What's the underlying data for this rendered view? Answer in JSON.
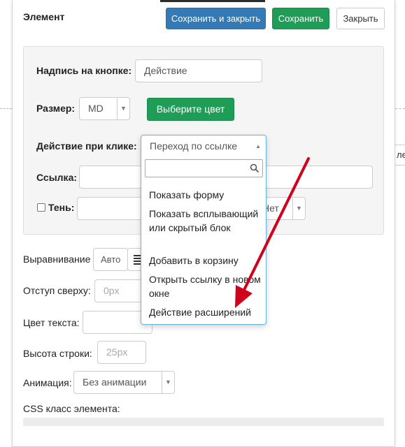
{
  "dialog": {
    "title": "Элемент",
    "buttons": {
      "save_close": "Сохранить и закрыть",
      "save": "Сохранить",
      "close": "Закрыть"
    }
  },
  "form": {
    "button_label": {
      "label": "Надпись на кнопке:",
      "value": "Действие"
    },
    "size": {
      "label": "Размер:",
      "value": "MD",
      "color_button": "Выберите цвет"
    },
    "click_action": {
      "label": "Действие при клике:",
      "selected": "Переход по ссылке",
      "search_value": "",
      "options": [
        "Показать форму",
        "Показать всплывающий или скрытый блок",
        "Добавить в корзину",
        "Открыть ссылку в новом окне",
        "Действие расширений"
      ]
    },
    "link": {
      "label": "Ссылка:",
      "value": ""
    },
    "shadow": {
      "label": "Тень:",
      "checked": false,
      "select_value": "Нет"
    },
    "alignment": {
      "label": "Выравнивание",
      "value": "Авто"
    },
    "margin_top": {
      "label": "Отступ сверху:",
      "placeholder": "0px"
    },
    "text_color": {
      "label": "Цвет текста:",
      "value": ""
    },
    "line_height": {
      "label": "Высота строки:",
      "placeholder": "25px"
    },
    "animation": {
      "label": "Анимация:",
      "value": "Без анимации"
    },
    "css_class": {
      "label": "CSS класс элемента:"
    }
  },
  "background": {
    "right_input_text": "ле"
  },
  "colors": {
    "primary": "#337ab7",
    "success": "#1f9c55",
    "annotation_arrow": "#d0021b"
  },
  "icons": {
    "search": "search-icon",
    "align": "align-justify-icon",
    "caret": "caret-down-icon",
    "arrow": "red-arrow-annotation"
  }
}
